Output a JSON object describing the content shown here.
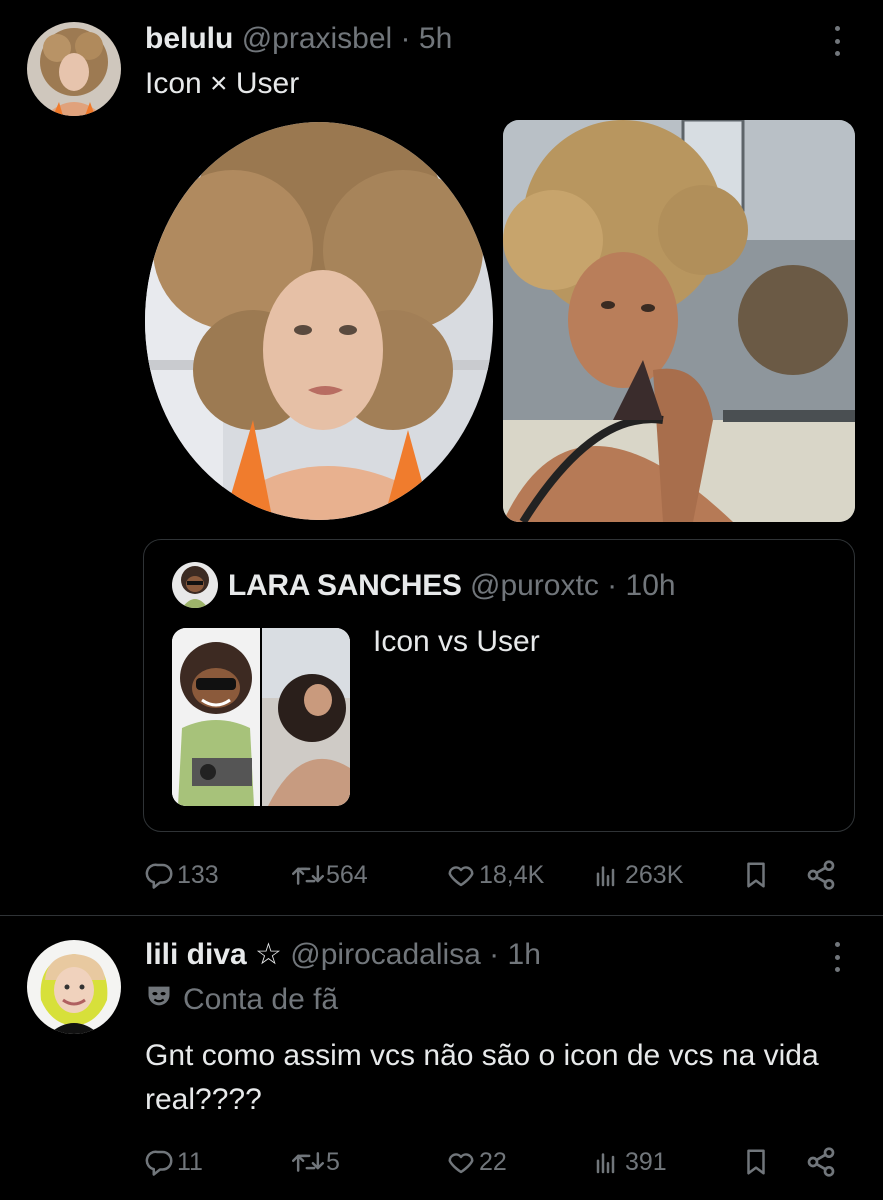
{
  "posts": [
    {
      "name": "belulu",
      "handle": "@praxisbel",
      "time": "5h",
      "text": "Icon × User",
      "quote": {
        "name": "LARA SANCHES",
        "handle": "@puroxtc",
        "time": "10h",
        "text": "Icon vs User"
      },
      "actions": {
        "replies": "133",
        "reposts": "564",
        "likes": "18,4K",
        "views": "263K"
      }
    },
    {
      "name": "lili diva ☆",
      "handle": "@pirocadalisa",
      "time": "1h",
      "badge": "Conta de fã",
      "text": "Gnt como assim vcs não são o icon de vcs na vida real????",
      "actions": {
        "replies": "11",
        "reposts": "5",
        "likes": "22",
        "views": "391"
      }
    }
  ],
  "separator": "·",
  "icons": {
    "reply": "reply-icon",
    "repost": "repost-icon",
    "like": "like-icon",
    "views": "views-icon",
    "bookmark": "bookmark-icon",
    "share": "share-icon",
    "more": "more-icon",
    "mask": "mask-icon"
  },
  "colors": {
    "background": "#000000",
    "text": "#e7e9ea",
    "secondary": "#71767b",
    "border": "#2f3336"
  }
}
